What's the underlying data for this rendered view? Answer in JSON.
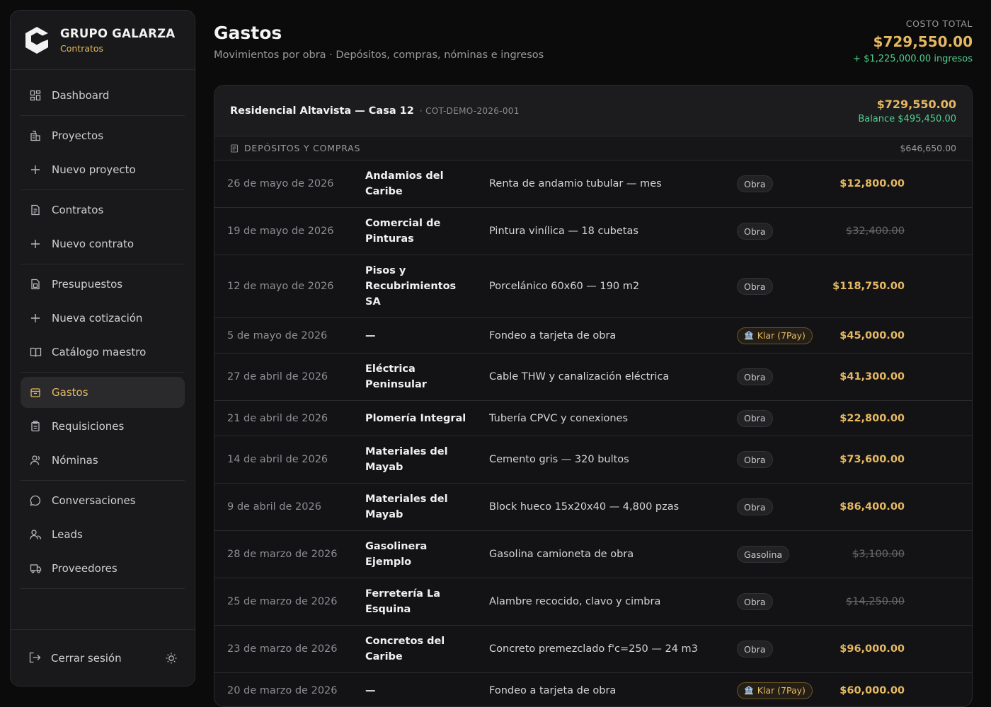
{
  "brand": {
    "name": "GRUPO GALARZA",
    "subtitle": "Contratos"
  },
  "nav": {
    "dashboard": "Dashboard",
    "proyectos": "Proyectos",
    "nuevo_proyecto": "Nuevo proyecto",
    "contratos": "Contratos",
    "nuevo_contrato": "Nuevo contrato",
    "presupuestos": "Presupuestos",
    "nueva_cotizacion": "Nueva cotización",
    "catalogo": "Catálogo maestro",
    "gastos": "Gastos",
    "requisiciones": "Requisiciones",
    "nominas": "Nóminas",
    "conversaciones": "Conversaciones",
    "leads": "Leads",
    "proveedores": "Proveedores",
    "logout": "Cerrar sesión"
  },
  "header": {
    "title": "Gastos",
    "subtitle": "Movimientos por obra · Depósitos, compras, nóminas e ingresos",
    "total_label": "COSTO TOTAL",
    "total_value": "$729,550.00",
    "total_income": "+ $1,225,000.00 ingresos"
  },
  "project": {
    "name": "Residencial Altavista — Casa 12",
    "code": "· COT-DEMO-2026-001",
    "amount": "$729,550.00",
    "balance": "Balance $495,450.00",
    "section_title": "DEPÓSITOS Y COMPRAS",
    "section_total": "$646,650.00"
  },
  "rows": [
    {
      "date": "26 de mayo de 2026",
      "provider": "Andamios del Caribe",
      "desc": "Renta de andamio tubular — mes",
      "tag": "Obra",
      "amount": "$12,800.00"
    },
    {
      "date": "19 de mayo de 2026",
      "provider": "Comercial de Pinturas",
      "desc": "Pintura vinílica — 18 cubetas",
      "tag": "Obra",
      "amount": "$32,400.00"
    },
    {
      "date": "12 de mayo de 2026",
      "provider": "Pisos y Recubrimientos SA",
      "desc": "Porcelánico 60x60 — 190 m2",
      "tag": "Obra",
      "amount": "$118,750.00"
    },
    {
      "date": "5 de mayo de 2026",
      "provider": "—",
      "desc": "Fondeo a tarjeta de obra",
      "tag": "Klar (7Pay)",
      "amount": "$45,000.00"
    },
    {
      "date": "27 de abril de 2026",
      "provider": "Eléctrica Peninsular",
      "desc": "Cable THW y canalización eléctrica",
      "tag": "Obra",
      "amount": "$41,300.00"
    },
    {
      "date": "21 de abril de 2026",
      "provider": "Plomería Integral",
      "desc": "Tubería CPVC y conexiones",
      "tag": "Obra",
      "amount": "$22,800.00"
    },
    {
      "date": "14 de abril de 2026",
      "provider": "Materiales del Mayab",
      "desc": "Cemento gris — 320 bultos",
      "tag": "Obra",
      "amount": "$73,600.00"
    },
    {
      "date": "9 de abril de 2026",
      "provider": "Materiales del Mayab",
      "desc": "Block hueco 15x20x40 — 4,800 pzas",
      "tag": "Obra",
      "amount": "$86,400.00"
    },
    {
      "date": "28 de marzo de 2026",
      "provider": "Gasolinera Ejemplo",
      "desc": "Gasolina camioneta de obra",
      "tag": "Gasolina",
      "amount": "$3,100.00"
    },
    {
      "date": "25 de marzo de 2026",
      "provider": "Ferretería La Esquina",
      "desc": "Alambre recocido, clavo y cimbra",
      "tag": "Obra",
      "amount": "$14,250.00"
    },
    {
      "date": "23 de marzo de 2026",
      "provider": "Concretos del Caribe",
      "desc": "Concreto premezclado f'c=250 — 24 m3",
      "tag": "Obra",
      "amount": "$96,000.00"
    },
    {
      "date": "20 de marzo de 2026",
      "provider": "—",
      "desc": "Fondeo a tarjeta de obra",
      "tag": "Klar (7Pay)",
      "amount": "$60,000.00"
    }
  ]
}
